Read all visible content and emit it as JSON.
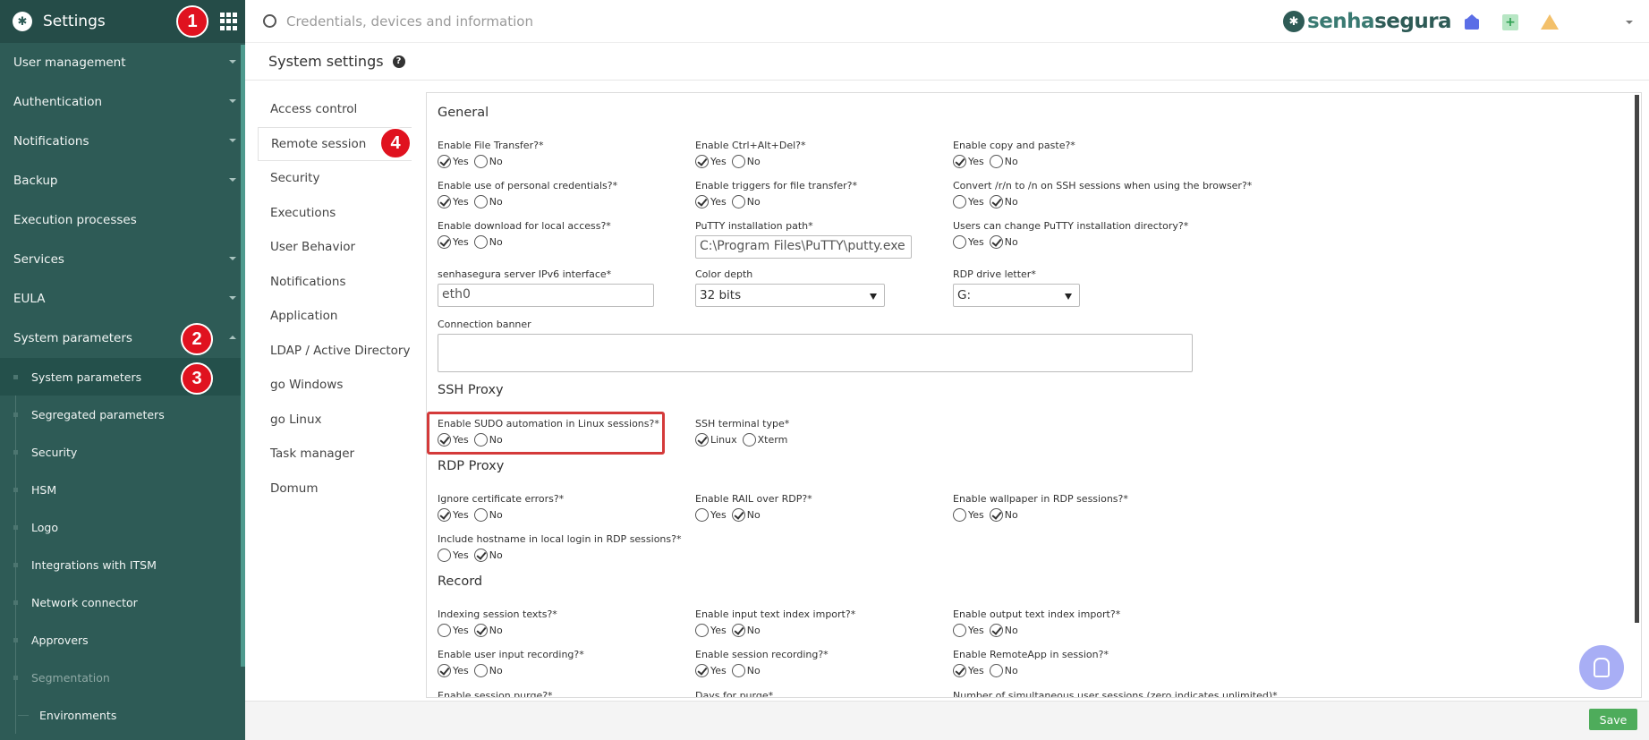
{
  "sidebar": {
    "title": "Settings",
    "items": [
      {
        "label": "User management"
      },
      {
        "label": "Authentication"
      },
      {
        "label": "Notifications"
      },
      {
        "label": "Backup"
      },
      {
        "label": "Execution processes"
      },
      {
        "label": "Services"
      },
      {
        "label": "EULA"
      },
      {
        "label": "System parameters"
      }
    ],
    "subitems": [
      {
        "label": "System parameters"
      },
      {
        "label": "Segregated parameters"
      },
      {
        "label": "Security"
      },
      {
        "label": "HSM"
      },
      {
        "label": "Logo"
      },
      {
        "label": "Integrations with ITSM"
      },
      {
        "label": "Network connector"
      },
      {
        "label": "Approvers"
      },
      {
        "label": "Segmentation"
      },
      {
        "label": "Environments"
      }
    ]
  },
  "badges": [
    "1",
    "2",
    "3",
    "4"
  ],
  "topbar": {
    "search_placeholder": "Credentials, devices and information",
    "brand_a": "senha",
    "brand_b": "segura"
  },
  "page": {
    "title": "System settings"
  },
  "subnav": [
    {
      "label": "Access control"
    },
    {
      "label": "Remote session"
    },
    {
      "label": "Security"
    },
    {
      "label": "Executions"
    },
    {
      "label": "User Behavior"
    },
    {
      "label": "Notifications"
    },
    {
      "label": "Application"
    },
    {
      "label": "LDAP / Active Directory"
    },
    {
      "label": "go Windows"
    },
    {
      "label": "go Linux"
    },
    {
      "label": "Task manager"
    },
    {
      "label": "Domum"
    }
  ],
  "sections": {
    "general": "General",
    "ssh": "SSH Proxy",
    "rdp": "RDP Proxy",
    "record": "Record"
  },
  "options": {
    "yes": "Yes",
    "no": "No",
    "linux": "Linux",
    "xterm": "Xterm"
  },
  "general": {
    "file_transfer": "Enable File Transfer?*",
    "ctrl_alt_del": "Enable Ctrl+Alt+Del?*",
    "copy_paste": "Enable copy and paste?*",
    "personal_creds": "Enable use of personal credentials?*",
    "file_triggers": "Enable triggers for file transfer?*",
    "convert_rn": "Convert /r/n to /n on SSH sessions when using the browser?*",
    "download_local": "Enable download for local access?*",
    "putty_path_label": "PuTTY installation path*",
    "putty_path_value": "C:\\Program Files\\PuTTY\\putty.exe",
    "putty_change": "Users can change PuTTY installation directory?*",
    "ipv6_label": "senhasegura server IPv6 interface*",
    "ipv6_value": "eth0",
    "color_depth_label": "Color depth",
    "color_depth_value": "32 bits",
    "rdp_drive_label": "RDP drive letter*",
    "rdp_drive_value": "G:",
    "banner_label": "Connection banner"
  },
  "ssh": {
    "sudo": "Enable SUDO automation in Linux sessions?*",
    "terminal": "SSH terminal type*"
  },
  "rdp": {
    "ignore_cert": "Ignore certificate errors?*",
    "rail": "Enable RAIL over RDP?*",
    "wallpaper": "Enable wallpaper in RDP sessions?*",
    "hostname": "Include hostname in local login in RDP sessions?*"
  },
  "record": {
    "indexing": "Indexing session texts?*",
    "input_index": "Enable input text index import?*",
    "output_index": "Enable output text index import?*",
    "user_input": "Enable user input recording?*",
    "session_rec": "Enable session recording?*",
    "remoteapp": "Enable RemoteApp in session?*",
    "purge": "Enable session purge?*",
    "days_purge": "Days for purge*",
    "simultaneous": "Number of simultaneous user sessions (zero indicates unlimited)*"
  },
  "footer": {
    "save_label": "Save"
  },
  "colors": {
    "sidebar": "#2e5b56",
    "badge": "#e0121f",
    "save": "#4eac5b",
    "highlight": "#d43a3a"
  }
}
